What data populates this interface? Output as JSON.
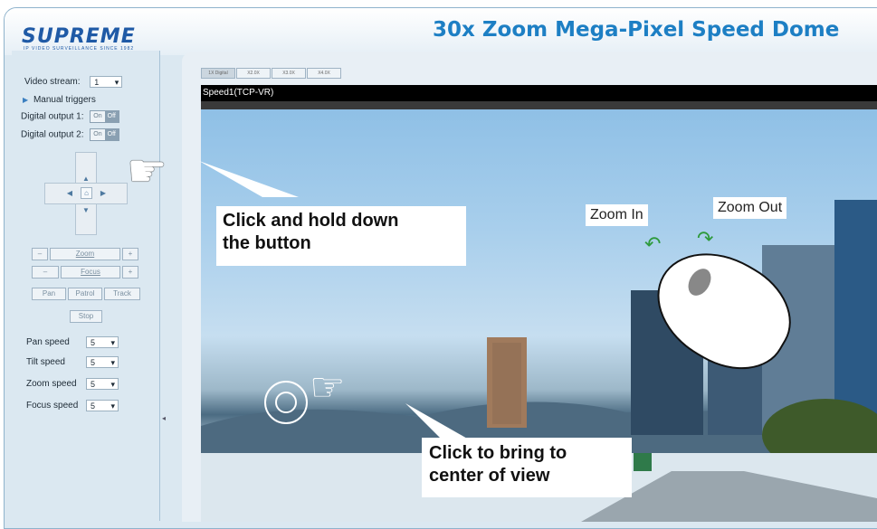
{
  "header": {
    "logo": "SUPREME",
    "logo_tagline": "IP VIDEO SURVEILLANCE SINCE 1982",
    "product_title": "30x Zoom Mega-Pixel Speed Dome"
  },
  "sidebar": {
    "video_stream_label": "Video stream:",
    "video_stream_value": "1",
    "manual_triggers": "Manual triggers",
    "digital_output_1": "Digital output 1:",
    "digital_output_2": "Digital output 2:",
    "on_label": "On",
    "off_label": "Off",
    "zoom_label": "Zoom",
    "focus_label": "Focus",
    "minus": "–",
    "plus": "+",
    "pan_button": "Pan",
    "patrol_button": "Patrol",
    "track_button": "Track",
    "stop_button": "Stop",
    "speeds": [
      {
        "label": "Pan speed",
        "value": "5"
      },
      {
        "label": "Tilt speed",
        "value": "5"
      },
      {
        "label": "Zoom speed",
        "value": "5"
      },
      {
        "label": "Focus speed",
        "value": "5"
      }
    ]
  },
  "viewer": {
    "tabs": [
      "1X Digital",
      "X2.0X",
      "X3.0X",
      "X4.0X"
    ],
    "stream_title": "Speed1(TCP-VR)"
  },
  "annotations": {
    "click_hold_line1": "Click and hold down",
    "click_hold_line2": "the button",
    "zoom_in": "Zoom In",
    "zoom_out": "Zoom Out",
    "click_center_line1": "Click to bring to",
    "click_center_line2": "center of view"
  }
}
